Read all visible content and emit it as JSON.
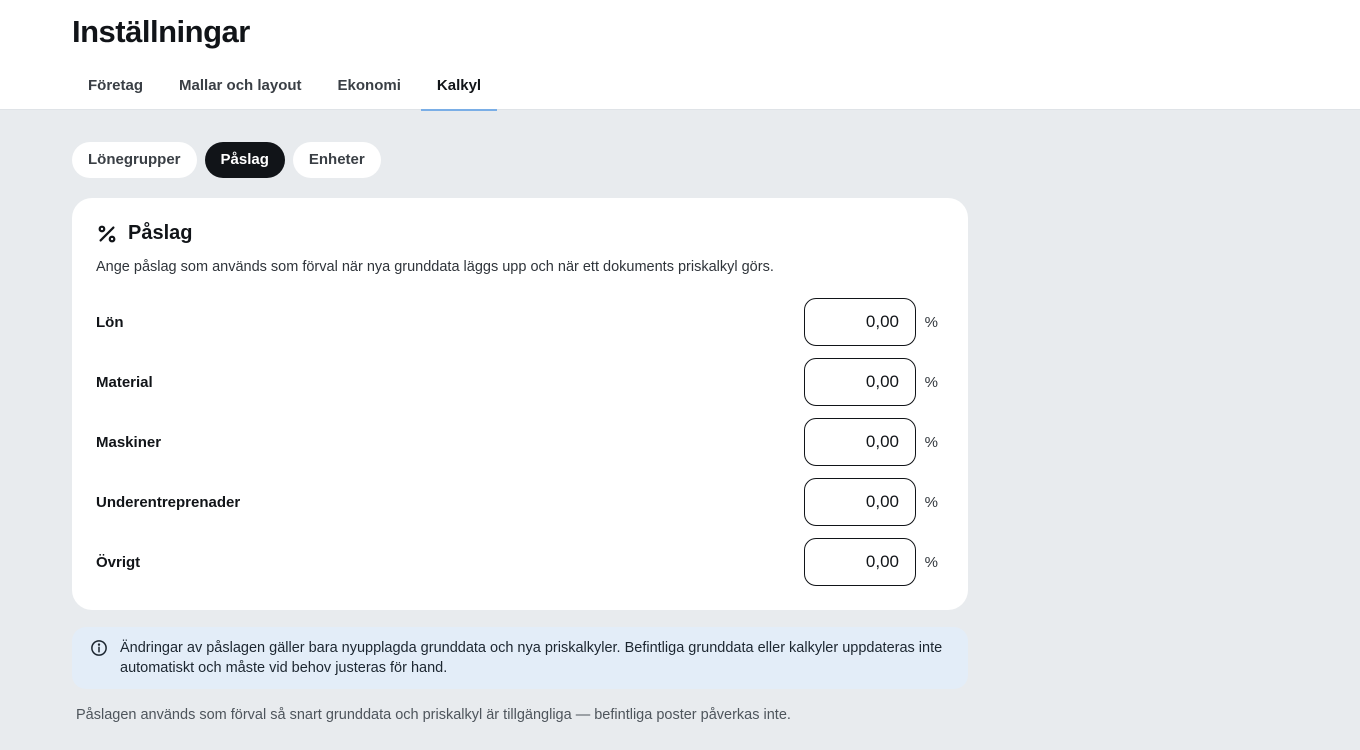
{
  "header": {
    "title": "Inställningar",
    "tabs": [
      {
        "label": "Företag"
      },
      {
        "label": "Mallar och layout"
      },
      {
        "label": "Ekonomi"
      },
      {
        "label": "Kalkyl"
      }
    ],
    "active_tab": "Kalkyl"
  },
  "subtabs": {
    "items": [
      {
        "label": "Lönegrupper"
      },
      {
        "label": "Påslag"
      },
      {
        "label": "Enheter"
      }
    ],
    "active": "Påslag"
  },
  "card": {
    "icon": "percent-icon",
    "title": "Påslag",
    "description": "Ange påslag som används som förval när nya grunddata läggs upp och när ett dokuments priskalkyl görs.",
    "unit": "%",
    "rows": [
      {
        "label": "Lön",
        "value": "0,00"
      },
      {
        "label": "Material",
        "value": "0,00"
      },
      {
        "label": "Maskiner",
        "value": "0,00"
      },
      {
        "label": "Underentreprenader",
        "value": "0,00"
      },
      {
        "label": "Övrigt",
        "value": "0,00"
      }
    ]
  },
  "info": {
    "icon": "info-icon",
    "text": "Ändringar av påslagen gäller bara nyupplagda grunddata och nya priskalkyler. Befintliga grunddata eller kalkyler uppdateras inte automatiskt och måste vid behov justeras för hand."
  },
  "footnote": "Påslagen används som förval så snart grunddata och priskalkyl är tillgängliga — befintliga poster påverkas inte.",
  "colors": {
    "background": "#e8ebee",
    "active_pill": "#111418",
    "tab_underline": "#7aaee6",
    "info_background": "#e3edf8"
  }
}
